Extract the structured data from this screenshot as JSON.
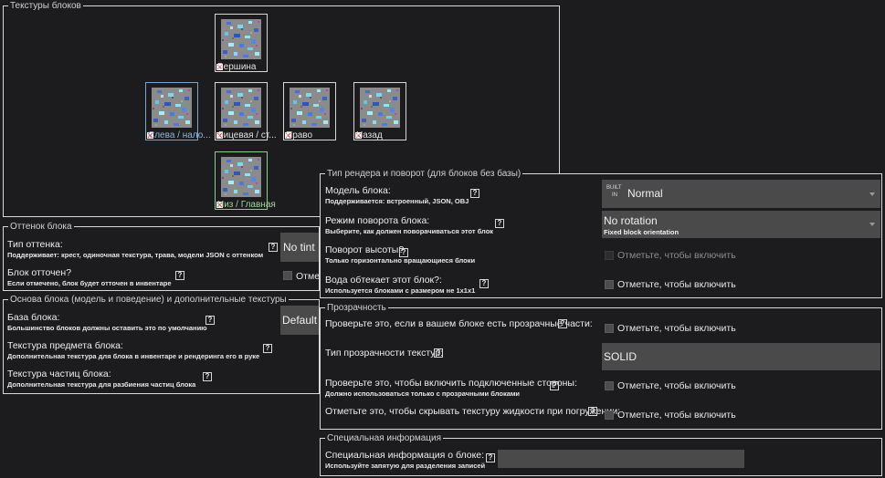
{
  "textures": {
    "title": "Текстуры блоков",
    "slots": [
      {
        "label": "Вершина",
        "variant": "normal",
        "icon": "diamond-ore-texture"
      },
      {
        "label": "Слева / нало...",
        "variant": "blue",
        "icon": "diamond-ore-texture"
      },
      {
        "label": "Лицевая / ст...",
        "variant": "normal",
        "icon": "diamond-ore-texture"
      },
      {
        "label": "Право",
        "variant": "normal",
        "icon": "diamond-ore-texture"
      },
      {
        "label": "Назад",
        "variant": "normal",
        "icon": "diamond-ore-texture"
      },
      {
        "label": "Низ / Главная",
        "variant": "green",
        "icon": "diamond-ore-texture"
      }
    ]
  },
  "tint": {
    "title": "Оттенок блока",
    "type_label": "Тип оттенка:",
    "type_hint": "Поддерживает: крест, одиночная текстура, трава, модели JSON с оттенком",
    "type_value": "No tint",
    "tinted_label": "Блок отточен?",
    "tinted_hint": "Если отмечено, блок будет отточен в инвентаре",
    "tinted_checkbox": "Отмет"
  },
  "base": {
    "title": "Основа блока (модель и поведение) и дополнительные текстуры",
    "base_label": "База блока:",
    "base_hint": "Большинство блоков должны оставить это по умолчанию",
    "base_value": "Default",
    "item_tex_label": "Текстура предмета блока:",
    "item_tex_hint": "Дополнительная текстура для блока в инвентаре и рендеринга его в руке",
    "particle_label": "Текстура частиц блока:",
    "particle_hint": "Дополнительная текстура для разбиения частиц блока"
  },
  "render": {
    "title": "Тип рендера и поворот (для блоков без базы)",
    "model_label": "Модель блока:",
    "model_hint": "Поддерживается: встроенный, JSON, OBJ",
    "model_badge_top": "BUILT",
    "model_badge_bottom": "IN",
    "model_value": "Normal",
    "rotation_label": "Режим поворота блока:",
    "rotation_hint": "Выберите, как должен поворачиваться этот блок",
    "rotation_value": "No rotation",
    "rotation_sub": "Fixed block orientation",
    "pitch_label": "Поворот высоты?",
    "pitch_hint": "Только горизонтально вращающиеся блоки",
    "pitch_checkbox": "Отметьте, чтобы включить",
    "water_label": "Вода обтекает этот блок?:",
    "water_hint": "Используется блоками с размером не 1x1x1",
    "water_checkbox": "Отметьте, чтобы включить"
  },
  "transparency": {
    "title": "Прозрачность",
    "check_label": "Проверьте это, если в вашем блоке есть прозрачные части:",
    "check_checkbox": "Отметьте, чтобы включить",
    "type_label": "Тип прозрачности текстур:",
    "type_value": "SOLID",
    "connected_label": "Проверьте это, чтобы включить подключенные стороны:",
    "connected_hint": "Должно использоваться только с прозрачными блоками",
    "connected_checkbox": "Отметьте, чтобы включить",
    "fluid_label": "Отметьте это, чтобы скрывать текстуру жидкости при погружении:",
    "fluid_checkbox": "Отметьте, чтобы включить"
  },
  "special": {
    "title": "Специальная информация",
    "label": "Специальная информация о блоке:",
    "hint": "Используйте запятую для разделения записей",
    "value": ""
  },
  "help_glyph": "?"
}
